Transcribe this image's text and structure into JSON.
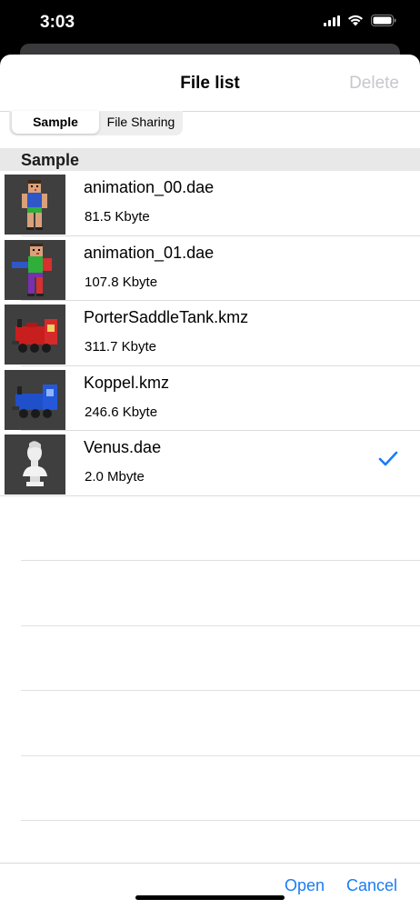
{
  "status_bar": {
    "time": "3:03"
  },
  "nav": {
    "title": "File list",
    "delete_label": "Delete"
  },
  "segments": {
    "active": "Sample",
    "inactive": "File Sharing"
  },
  "section": {
    "title": "Sample"
  },
  "files": [
    {
      "name": "animation_00.dae",
      "size": "81.5 Kbyte",
      "thumb_icon": "character-blue-shirt-icon",
      "selected": false
    },
    {
      "name": "animation_01.dae",
      "size": "107.8 Kbyte",
      "thumb_icon": "character-green-shirt-icon",
      "selected": false
    },
    {
      "name": "PorterSaddleTank.kmz",
      "size": "311.7 Kbyte",
      "thumb_icon": "red-locomotive-icon",
      "selected": false
    },
    {
      "name": "Koppel.kmz",
      "size": "246.6 Kbyte",
      "thumb_icon": "blue-locomotive-icon",
      "selected": false
    },
    {
      "name": "Venus.dae",
      "size": "2.0 Mbyte",
      "thumb_icon": "venus-bust-icon",
      "selected": true
    }
  ],
  "toolbar": {
    "open_label": "Open",
    "cancel_label": "Cancel"
  },
  "colors": {
    "accent": "#1a7cf5",
    "disabled": "#c7c7cc",
    "section_bg": "#e8e8e8",
    "thumb_bg": "#3f3f3f"
  }
}
